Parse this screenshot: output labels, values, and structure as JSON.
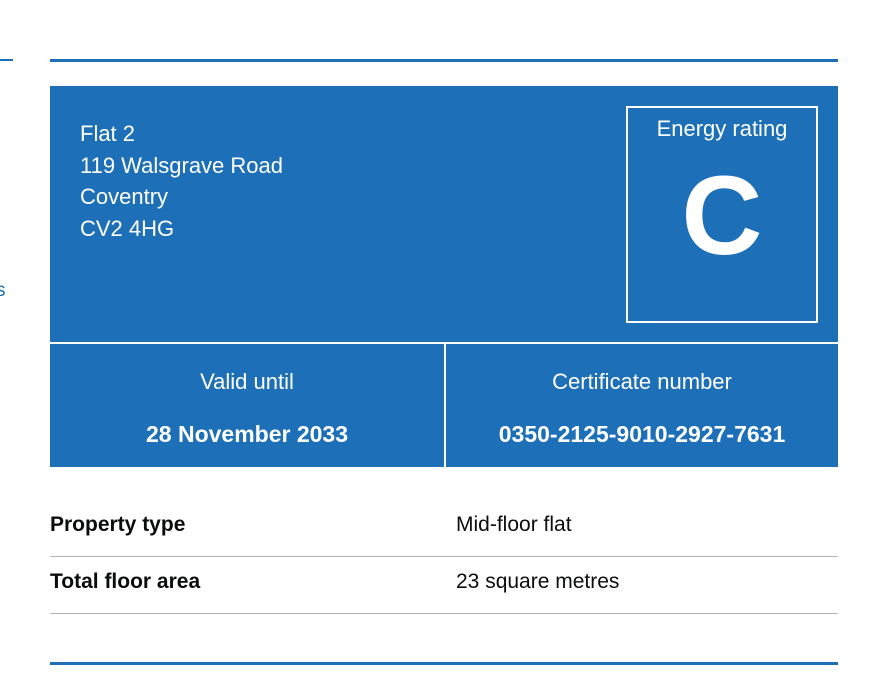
{
  "address": {
    "line1": "Flat 2",
    "line2": "119 Walsgrave Road",
    "line3": "Coventry",
    "postcode": "CV2 4HG"
  },
  "energy_rating": {
    "label": "Energy rating",
    "value": "C"
  },
  "validity": {
    "label": "Valid until",
    "value": "28 November 2033"
  },
  "certificate": {
    "label": "Certificate number",
    "value": "0350-2125-9010-2927-7631"
  },
  "summary": [
    {
      "key": "Property type",
      "value": "Mid-floor flat"
    },
    {
      "key": "Total floor area",
      "value": "23 square metres"
    }
  ],
  "left_edge_glyph": "s",
  "colors": {
    "primary_blue": "#1d70b8",
    "text": "#0b0c0c",
    "border_grey": "#b1b4b6"
  }
}
